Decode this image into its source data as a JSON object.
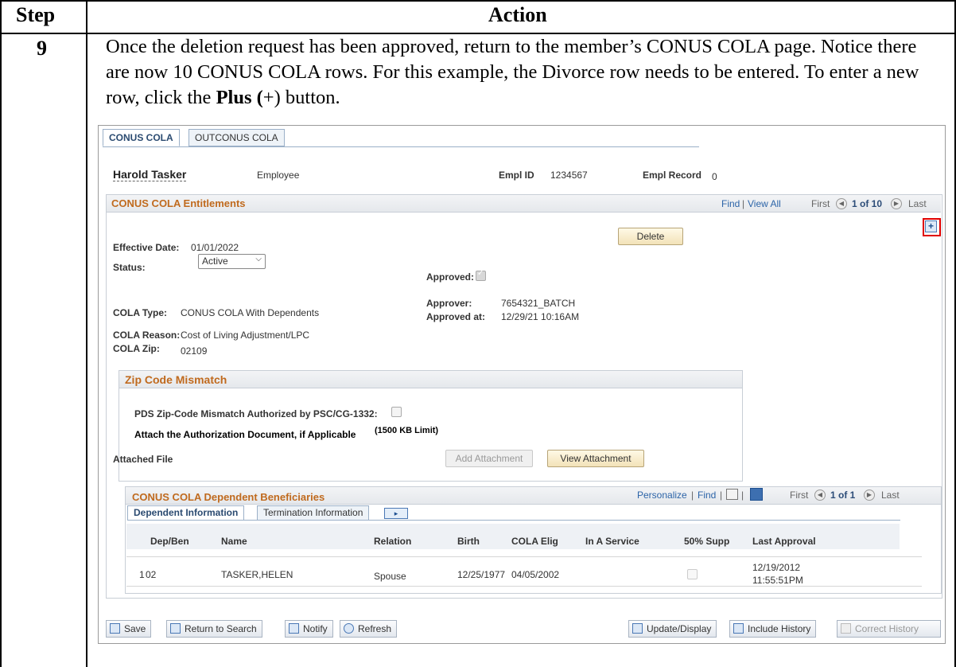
{
  "doc": {
    "step_header": "Step",
    "action_header": "Action",
    "step_number": "9",
    "instruction_part1": "Once the deletion request has been approved, return to the member’s CONUS COLA page.  Notice there are now 10 CONUS COLA rows.  For this example, the Divorce row needs to be entered.  To enter a new row, click the ",
    "instruction_bold": "Plus (",
    "instruction_plus": "+)",
    "instruction_part2": " button."
  },
  "tabs": [
    "CONUS COLA",
    "OUTCONUS COLA"
  ],
  "employee": {
    "name": "Harold Tasker",
    "type": "Employee",
    "empl_id_label": "Empl ID",
    "empl_id": "1234567",
    "empl_record_label": "Empl Record",
    "empl_record": "0"
  },
  "entitlements": {
    "title": "CONUS COLA Entitlements",
    "find": "Find",
    "view_all": "View All",
    "first": "First",
    "count": "1 of 10",
    "last": "Last",
    "delete": "Delete",
    "effective_date_label": "Effective Date:",
    "effective_date": "01/01/2022",
    "status_label": "Status:",
    "status_value": "Active",
    "approved_label": "Approved:",
    "approver_label": "Approver:",
    "approver": "7654321_BATCH",
    "approved_at_label": "Approved at:",
    "approved_at": "12/29/21 10:16AM",
    "cola_type_label": "COLA Type:",
    "cola_type": "CONUS COLA With Dependents",
    "cola_reason_label": "COLA Reason:",
    "cola_reason": "Cost of Living Adjustment/LPC",
    "cola_zip_label": "COLA Zip:",
    "cola_zip": "02109",
    "plus": "+"
  },
  "zip_mismatch": {
    "title": "Zip Code Mismatch",
    "pds_label": "PDS Zip-Code Mismatch Authorized by PSC/CG-1332:",
    "attach_label": "Attach the Authorization Document, if Applicable",
    "limit": "(1500 KB Limit)",
    "attached_file": "Attached File",
    "add_attachment": "Add Attachment",
    "view_attachment": "View Attachment"
  },
  "dependents": {
    "title": "CONUS COLA Dependent Beneficiaries",
    "personalize": "Personalize",
    "find": "Find",
    "first": "First",
    "count": "1 of 1",
    "last": "Last",
    "tabs": [
      "Dependent Information",
      "Termination Information"
    ],
    "columns": [
      "Dep/Ben",
      "Name",
      "Relation",
      "Birth",
      "COLA Elig",
      "In A Service",
      "50% Supp",
      "Last Approval"
    ],
    "row": {
      "num": "1",
      "dep_ben": "02",
      "name": "TASKER,HELEN",
      "relation": "Spouse",
      "birth": "12/25/1977",
      "cola_elig": "04/05/2002",
      "last_approval_date": "12/19/2012",
      "last_approval_time": "11:55:51PM"
    }
  },
  "toolbar": {
    "save": "Save",
    "return": "Return to Search",
    "notify": "Notify",
    "refresh": "Refresh",
    "update": "Update/Display",
    "include_history": "Include History",
    "correct_history": "Correct History"
  },
  "colors": {
    "accent": "#c06a1e",
    "link": "#2c64a8",
    "highlight": "#e00000"
  }
}
